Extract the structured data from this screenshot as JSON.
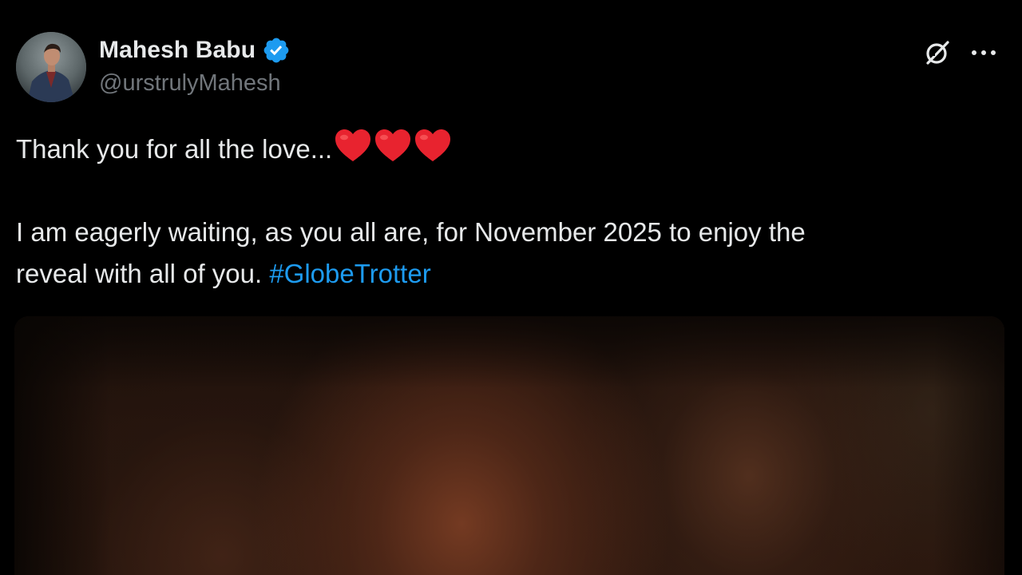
{
  "post": {
    "author": {
      "display_name": "Mahesh Babu",
      "handle": "@urstrulyMahesh",
      "verified": true,
      "verified_icon": "verified-badge-icon",
      "avatar_icon": "profile-photo"
    },
    "header_actions": {
      "grok_icon": "grok-icon",
      "more_icon": "more-options-icon"
    },
    "text": {
      "line1": "Thank you for all the love...",
      "hearts_count": 3,
      "heart_icon": "red-heart-emoji",
      "line2": "I am eagerly waiting, as you all are, for November 2025 to enjoy the",
      "line3_text": "reveal with all of you. ",
      "hashtag": "#GlobeTrotter"
    },
    "media": {
      "type": "image",
      "icon": "blurred-photo"
    }
  },
  "colors": {
    "background": "#000000",
    "primary_text": "#e7e9ea",
    "secondary_text": "#71767b",
    "link": "#1d9bf0",
    "verified": "#1d9bf0",
    "heart": "#e8232f"
  }
}
